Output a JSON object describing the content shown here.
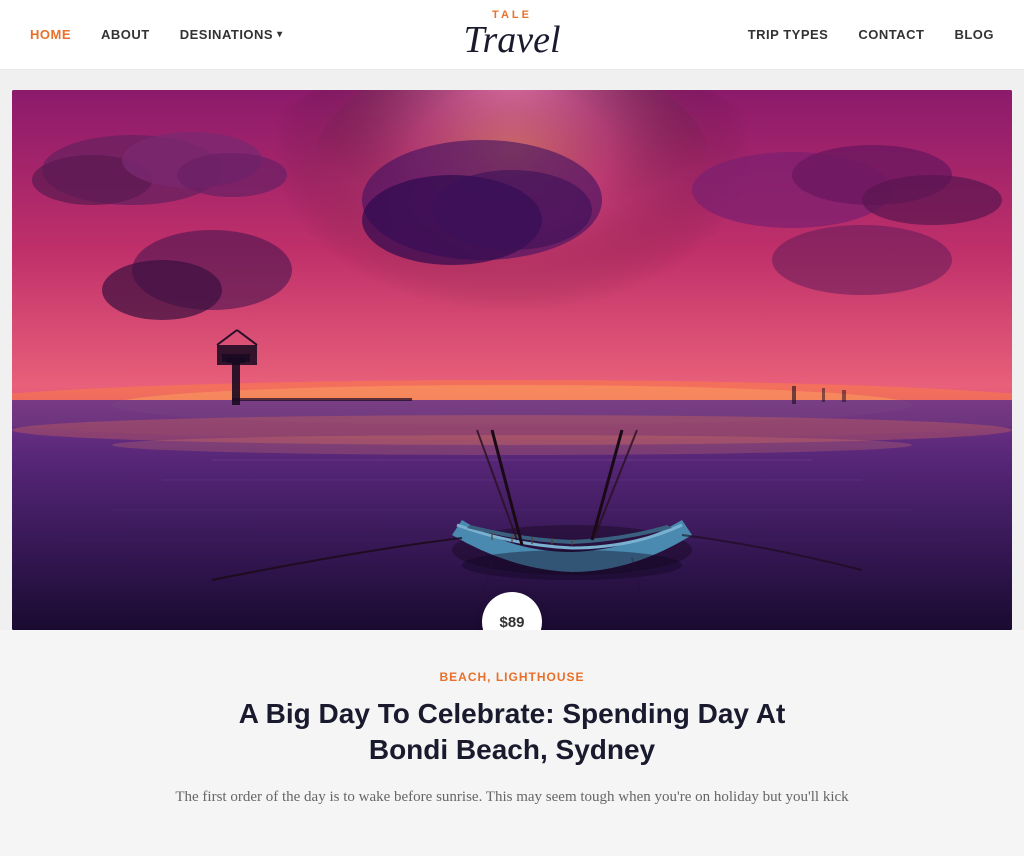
{
  "nav": {
    "logo_tale": "TALE",
    "logo_travel": "Travel",
    "left_items": [
      {
        "label": "HOME",
        "active": true,
        "has_dropdown": false
      },
      {
        "label": "ABOUT",
        "active": false,
        "has_dropdown": false
      },
      {
        "label": "DESINATIONS",
        "active": false,
        "has_dropdown": true
      }
    ],
    "right_items": [
      {
        "label": "TRIP TYPES",
        "active": false
      },
      {
        "label": "CONTACT",
        "active": false
      },
      {
        "label": "BLOG",
        "active": false
      }
    ]
  },
  "hero": {
    "price": "$89",
    "image_alt": "Boat at sunset on calm water"
  },
  "article": {
    "categories": "BEACH, LIGHTHOUSE",
    "title": "A Big Day To Celebrate: Spending Day At Bondi Beach, Sydney",
    "excerpt": "The first order of the day is to wake before sunrise. This may seem tough when you're on holiday but you'll kick"
  }
}
